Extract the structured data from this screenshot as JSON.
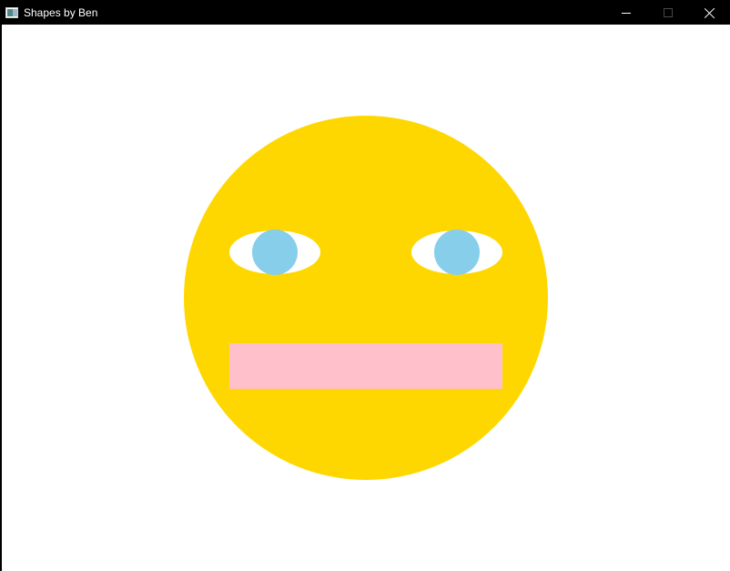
{
  "window": {
    "title": "Shapes by Ben",
    "controls": {
      "minimize_icon": "minimize-icon",
      "maximize_icon": "maximize-icon",
      "close_icon": "close-icon"
    }
  },
  "canvas": {
    "background_color": "#ffffff",
    "face": {
      "color": "#ffd700"
    },
    "eyes": {
      "sclera_color": "#ffffff",
      "iris_color": "#87ceeb"
    },
    "mouth": {
      "color": "#ffc0cb"
    }
  }
}
